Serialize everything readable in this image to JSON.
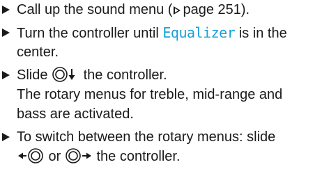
{
  "steps": [
    {
      "parts": {
        "before": "Call up the sound menu (",
        "page_ref": "page 251",
        "after": ")."
      }
    },
    {
      "parts": {
        "before": "Turn the controller until ",
        "display_text": "Equalizer",
        "after_line1": " is in the",
        "line2": "center."
      }
    },
    {
      "parts": {
        "before": "Slide ",
        "after": " the controller.",
        "line2": "The rotary menus for treble, mid-range and",
        "line3": "bass are activated."
      }
    },
    {
      "parts": {
        "line1": "To switch between the rotary menus: slide",
        "middle": " or ",
        "after": " the controller."
      }
    }
  ],
  "icons": {
    "bullet": "triangle-bullet-icon",
    "page_ref": "page-reference-triangle-icon",
    "controller_down": "controller-slide-down-icon",
    "controller_left": "controller-slide-left-icon",
    "controller_right": "controller-slide-right-icon"
  },
  "colors": {
    "text": "#1a1a1a",
    "display_text": "#1aa0d8"
  }
}
